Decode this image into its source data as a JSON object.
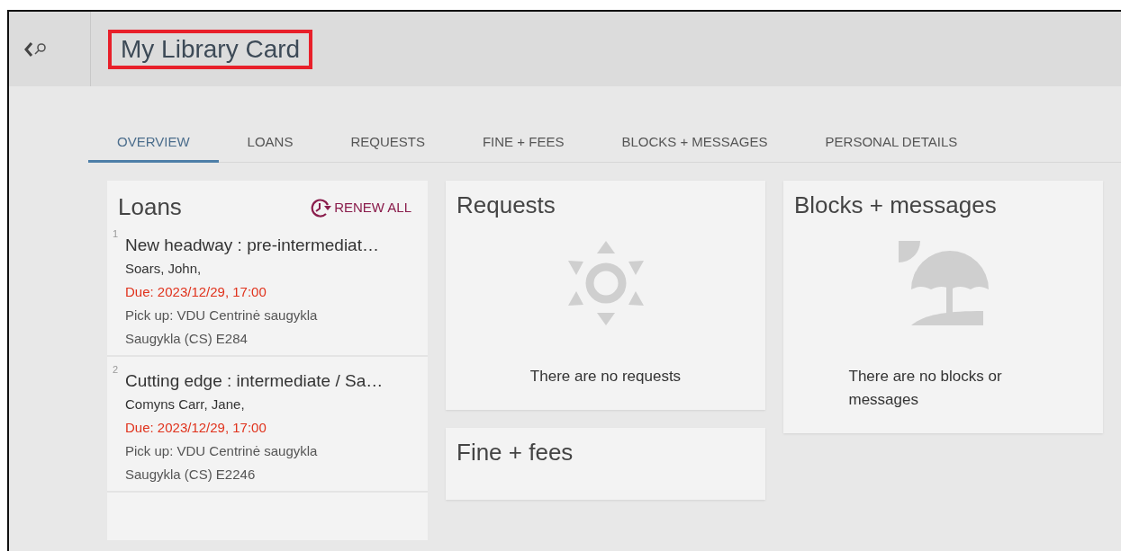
{
  "header": {
    "title": "My Library Card",
    "title_highlighted": true
  },
  "tabs": [
    {
      "label": "OVERVIEW",
      "selected": true
    },
    {
      "label": "LOANS",
      "selected": false
    },
    {
      "label": "REQUESTS",
      "selected": false
    },
    {
      "label": "FINE + FEES",
      "selected": false
    },
    {
      "label": "BLOCKS + MESSAGES",
      "selected": false
    },
    {
      "label": "PERSONAL DETAILS",
      "selected": false
    }
  ],
  "loans": {
    "title": "Loans",
    "renew_all": "RENEW ALL",
    "items": [
      {
        "number": "1",
        "title": "New headway : pre-intermediat…",
        "author": "Soars, John,",
        "due": "Due: 2023/12/29, 17:00",
        "overdue": true,
        "pickup": "Pick up: VDU Centrinė saugykla",
        "location": "Saugykla (CS) E284"
      },
      {
        "number": "2",
        "title": "Cutting edge : intermediate / Sa…",
        "author": "Comyns Carr, Jane,",
        "due": "Due: 2023/12/29, 17:00",
        "overdue": true,
        "pickup": "Pick up: VDU Centrinė saugykla",
        "location": "Saugykla (CS) E2246"
      }
    ]
  },
  "requests": {
    "title": "Requests",
    "kind": "sun",
    "message": "There are no requests"
  },
  "fines": {
    "title": "Fine + fees"
  },
  "blocks": {
    "title": "Blocks + messages",
    "kind": "beach",
    "message": "There are no blocks or messages"
  }
}
